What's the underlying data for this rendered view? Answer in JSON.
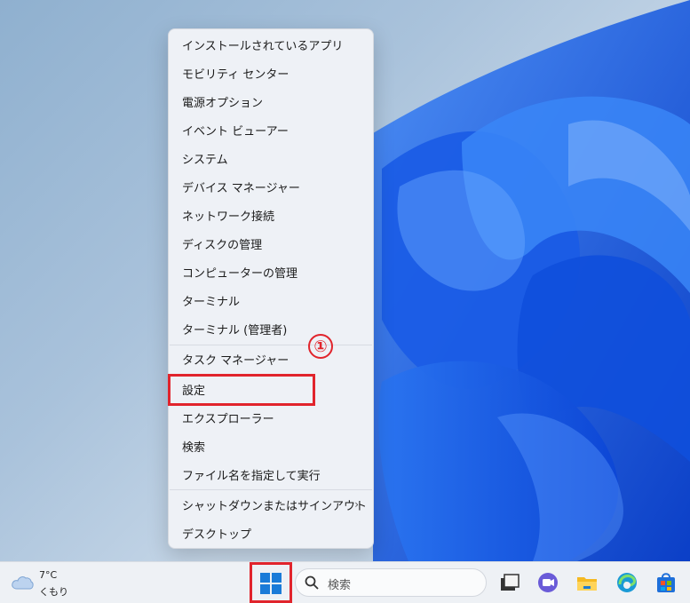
{
  "menu": {
    "items": [
      {
        "label": "インストールされているアプリ"
      },
      {
        "label": "モビリティ センター"
      },
      {
        "label": "電源オプション"
      },
      {
        "label": "イベント ビューアー"
      },
      {
        "label": "システム"
      },
      {
        "label": "デバイス マネージャー"
      },
      {
        "label": "ネットワーク接続"
      },
      {
        "label": "ディスクの管理"
      },
      {
        "label": "コンピューターの管理"
      },
      {
        "label": "ターミナル"
      },
      {
        "label": "ターミナル (管理者)"
      },
      {
        "label": "タスク マネージャー"
      },
      {
        "label": "設定"
      },
      {
        "label": "エクスプローラー"
      },
      {
        "label": "検索"
      },
      {
        "label": "ファイル名を指定して実行"
      },
      {
        "label": "シャットダウンまたはサインアウト",
        "submenu_glyph": "›"
      },
      {
        "label": "デスクトップ"
      }
    ]
  },
  "annotation": {
    "marker": "①",
    "color": "#e1242c"
  },
  "taskbar": {
    "weather": {
      "temp": "7°C",
      "condition": "くもり",
      "icon": "cloud-icon"
    },
    "start_icon": "windows-logo-icon",
    "search": {
      "placeholder": "検索",
      "icon": "search-icon"
    },
    "pinned": [
      {
        "name": "task-view-icon"
      },
      {
        "name": "chat-icon"
      },
      {
        "name": "file-explorer-icon"
      },
      {
        "name": "edge-icon"
      },
      {
        "name": "store-icon"
      }
    ]
  },
  "colors": {
    "accent": "#0067c0",
    "highlight": "#e1242c",
    "wallpaper_blue": "#1f5ee8"
  }
}
